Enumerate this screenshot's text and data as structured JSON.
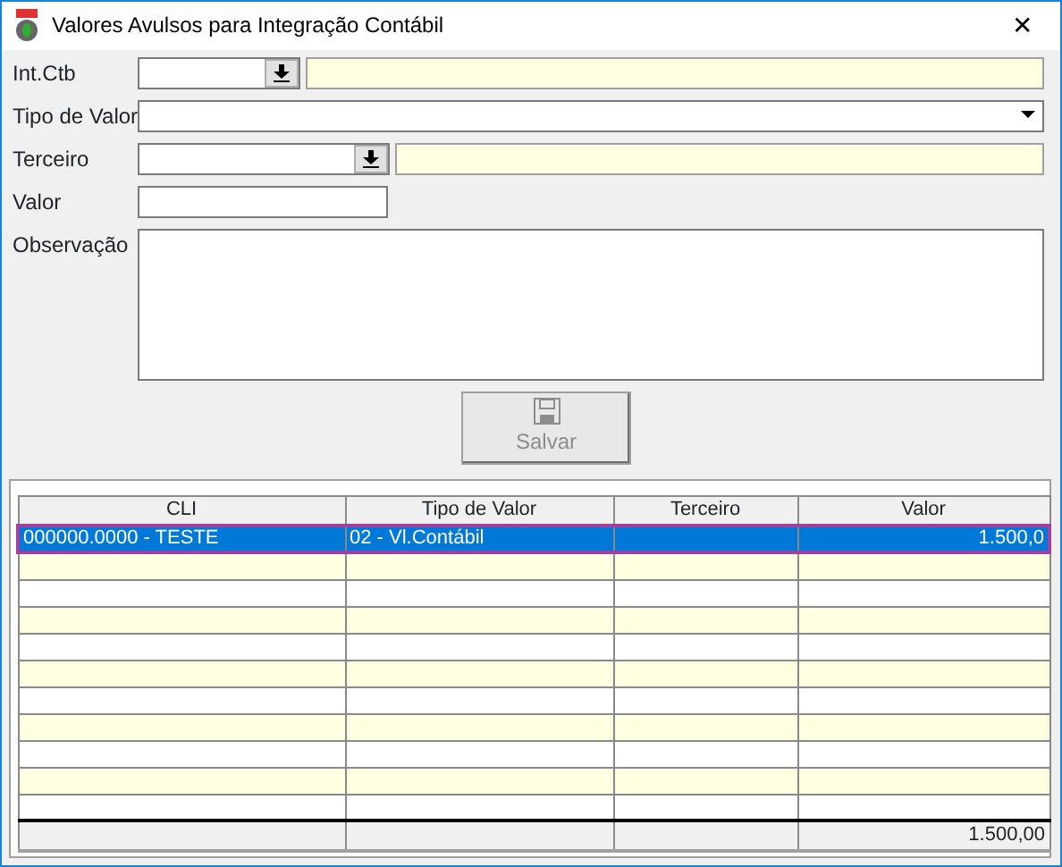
{
  "window": {
    "title": "Valores Avulsos para Integração Contábil",
    "close": "✕"
  },
  "form": {
    "fields": [
      {
        "label": "Int.Ctb",
        "kind": "lookup"
      },
      {
        "label": "Tipo de Valor",
        "kind": "select"
      },
      {
        "label": "Terceiro",
        "kind": "lookup"
      },
      {
        "label": "Valor",
        "kind": "text"
      },
      {
        "label": "Observação",
        "kind": "memo"
      }
    ],
    "save_button": {
      "label": "Salvar",
      "disabled": true
    }
  },
  "table": {
    "columns": [
      "CLI",
      "Tipo de Valor",
      "Terceiro",
      "Valor"
    ],
    "rows": [
      {
        "cells": {
          "cli": "000000.0000 - TESTE",
          "tipo_de_valor": "02 - Vl.Contábil",
          "valor": "1.500,0"
        },
        "selected": true
      }
    ],
    "footer": {
      "valor": "1.500,00"
    }
  }
}
